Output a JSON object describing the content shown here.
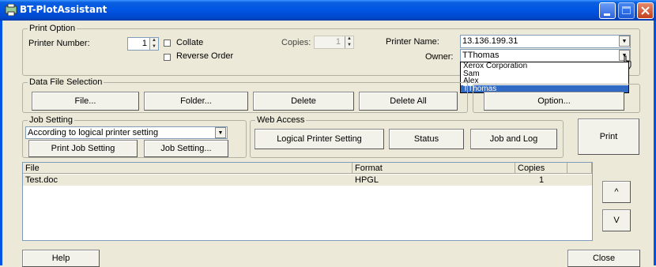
{
  "window": {
    "title": "BT-PlotAssistant"
  },
  "print_option": {
    "legend": "Print Option",
    "printer_number_label": "Printer Number:",
    "printer_number_value": "1",
    "collate_label": "Collate",
    "reverse_order_label": "Reverse Order",
    "copies_label": "Copies:",
    "copies_value": "1",
    "printer_name_label": "Printer Name:",
    "printer_name_value": "13.136.199.31",
    "owner_label": "Owner:",
    "owner_value": "TThomas",
    "owner_options": [
      "Xerox Corporation",
      "Sam",
      "Alex",
      "TThomas"
    ]
  },
  "data_file": {
    "legend": "Data File Selection",
    "file_btn": "File...",
    "folder_btn": "Folder...",
    "delete_btn": "Delete",
    "delete_all_btn": "Delete All",
    "option_btn": "Option..."
  },
  "job_setting": {
    "legend": "Job Setting",
    "select_value": "According to logical printer setting",
    "print_job_btn": "Print Job Setting",
    "job_setting_btn": "Job Setting..."
  },
  "web_access": {
    "legend": "Web Access",
    "logical_btn": "Logical Printer Setting",
    "status_btn": "Status",
    "job_log_btn": "Job and Log"
  },
  "print_btn": "Print",
  "table": {
    "headers": [
      "File",
      "Format",
      "Copies"
    ],
    "rows": [
      {
        "file": "Test.doc",
        "format": "HPGL",
        "copies": "1"
      }
    ]
  },
  "up_btn": "^",
  "down_btn": "V",
  "help_btn": "Help",
  "close_btn": "Close"
}
